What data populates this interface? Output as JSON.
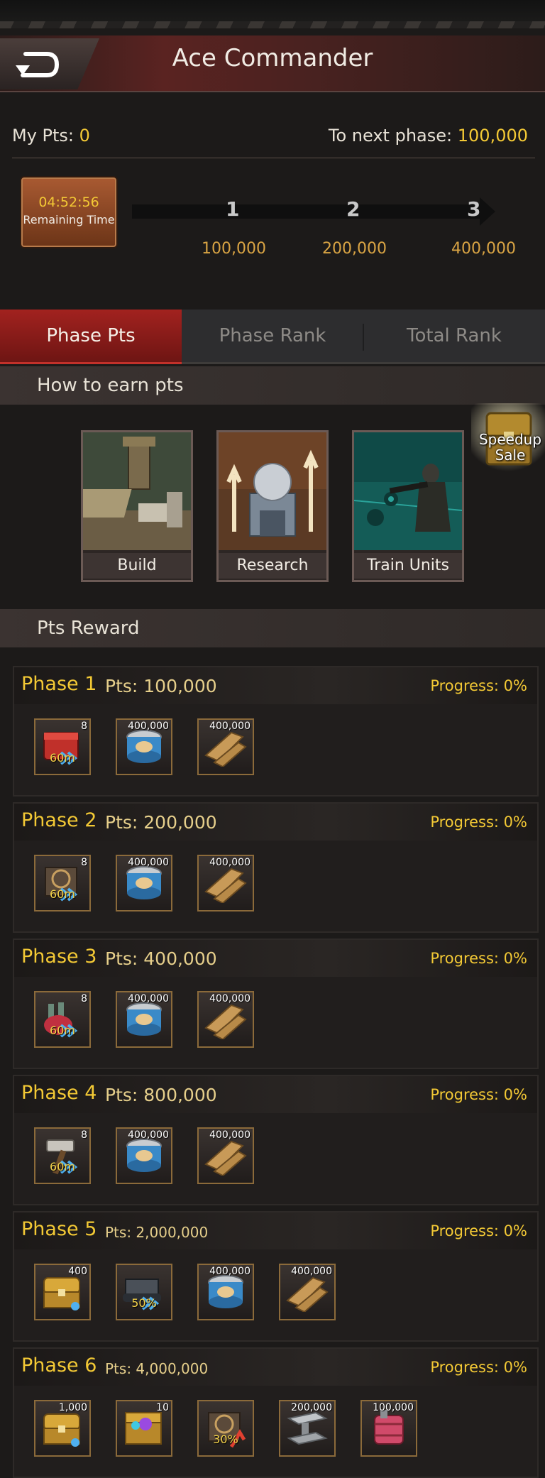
{
  "header": {
    "title": "Ace Commander"
  },
  "stats": {
    "my_pts_label": "My Pts:",
    "my_pts_value": "0",
    "next_phase_label": "To next phase:",
    "next_phase_value": "100,000"
  },
  "timer": {
    "time": "04:52:56",
    "label": "Remaining Time"
  },
  "phases_track": [
    {
      "num": "1",
      "target": "100,000"
    },
    {
      "num": "2",
      "target": "200,000"
    },
    {
      "num": "3",
      "target": "400,000"
    }
  ],
  "tabs": [
    {
      "label": "Phase Pts",
      "active": true
    },
    {
      "label": "Phase Rank",
      "active": false
    },
    {
      "label": "Total Rank",
      "active": false
    }
  ],
  "earn": {
    "title": "How to earn pts",
    "cards": [
      "Build",
      "Research",
      "Train Units"
    ],
    "speedup_line1": "Speedup",
    "speedup_line2": "Sale"
  },
  "reward": {
    "title": "Pts Reward"
  },
  "phases": [
    {
      "name": "Phase 1",
      "pts": "Pts: 100,000",
      "progress": "Progress: 0%",
      "items": [
        {
          "icon": "red-chest-icon",
          "qty": "8",
          "overlay": "60m"
        },
        {
          "icon": "food-can-icon",
          "qty": "400,000",
          "overlay": ""
        },
        {
          "icon": "wood-planks-icon",
          "qty": "400,000",
          "overlay": ""
        }
      ]
    },
    {
      "name": "Phase 2",
      "pts": "Pts: 200,000",
      "progress": "Progress: 0%",
      "items": [
        {
          "icon": "training-speedup-icon",
          "qty": "8",
          "overlay": "60m"
        },
        {
          "icon": "food-can-icon",
          "qty": "400,000",
          "overlay": ""
        },
        {
          "icon": "wood-planks-icon",
          "qty": "400,000",
          "overlay": ""
        }
      ]
    },
    {
      "name": "Phase 3",
      "pts": "Pts: 400,000",
      "progress": "Progress: 0%",
      "items": [
        {
          "icon": "research-flask-icon",
          "qty": "8",
          "overlay": "60m"
        },
        {
          "icon": "food-can-icon",
          "qty": "400,000",
          "overlay": ""
        },
        {
          "icon": "wood-planks-icon",
          "qty": "400,000",
          "overlay": ""
        }
      ]
    },
    {
      "name": "Phase 4",
      "pts": "Pts: 800,000",
      "progress": "Progress: 0%",
      "items": [
        {
          "icon": "build-hammer-icon",
          "qty": "8",
          "overlay": "60m"
        },
        {
          "icon": "food-can-icon",
          "qty": "400,000",
          "overlay": ""
        },
        {
          "icon": "wood-planks-icon",
          "qty": "400,000",
          "overlay": ""
        }
      ]
    },
    {
      "name": "Phase 5",
      "pts": "Pts: 2,000,000",
      "progress": "Progress: 0%",
      "items": [
        {
          "icon": "gold-chest-icon",
          "qty": "400",
          "overlay": ""
        },
        {
          "icon": "tank-boost-icon",
          "qty": "",
          "overlay": "50%"
        },
        {
          "icon": "food-can-icon",
          "qty": "400,000",
          "overlay": ""
        },
        {
          "icon": "wood-planks-icon",
          "qty": "400,000",
          "overlay": ""
        }
      ]
    },
    {
      "name": "Phase 6",
      "pts": "Pts: 4,000,000",
      "progress": "Progress: 0%",
      "items": [
        {
          "icon": "gold-chest-icon",
          "qty": "1,000",
          "overlay": ""
        },
        {
          "icon": "gem-chest-icon",
          "qty": "10",
          "overlay": ""
        },
        {
          "icon": "training-boost-icon",
          "qty": "",
          "overlay": "30%"
        },
        {
          "icon": "steel-beam-icon",
          "qty": "200,000",
          "overlay": ""
        },
        {
          "icon": "oil-barrel-icon",
          "qty": "100,000",
          "overlay": ""
        }
      ]
    }
  ],
  "colors": {
    "accent_gold": "#f3c935",
    "tab_red": "#a2221f",
    "progress_text": "#f3c935"
  }
}
